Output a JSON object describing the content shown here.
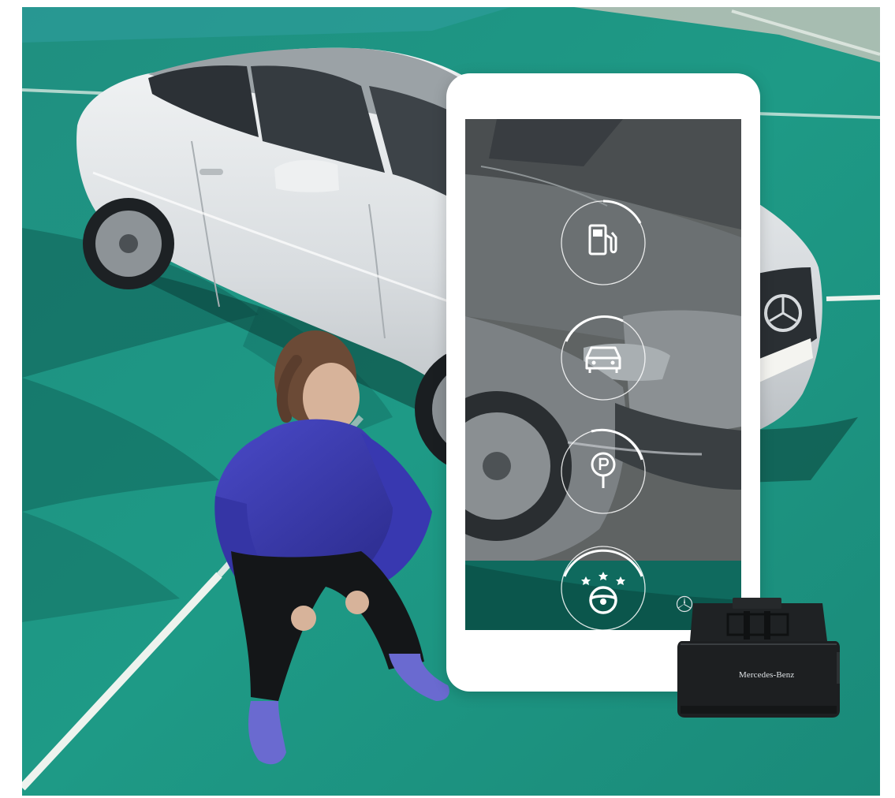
{
  "scene": {
    "background_color": "#1e9a86",
    "car_color": "#e3e6e8"
  },
  "phone_app": {
    "accent": "#ffffff",
    "features": [
      {
        "icon": "fuel-pump-icon"
      },
      {
        "icon": "car-front-icon"
      },
      {
        "icon": "parking-pin-icon"
      },
      {
        "icon": "steering-wheel-stars-icon"
      }
    ]
  },
  "adapter": {
    "brand_text": "Mercedes-Benz",
    "body_color": "#1d1f21"
  }
}
